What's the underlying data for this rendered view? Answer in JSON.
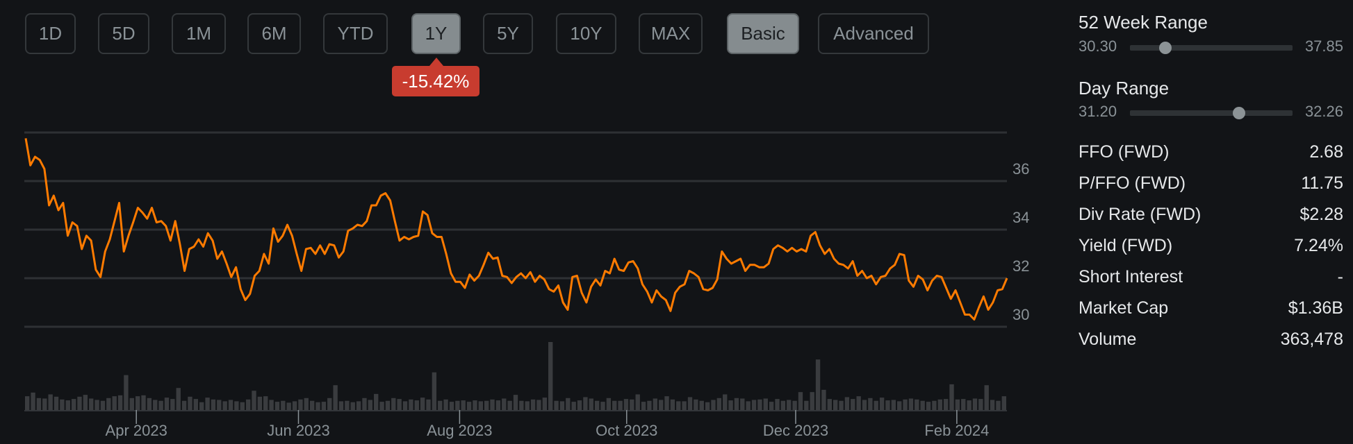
{
  "range_buttons": [
    {
      "label": "1D",
      "active": false
    },
    {
      "label": "5D",
      "active": false
    },
    {
      "label": "1M",
      "active": false
    },
    {
      "label": "6M",
      "active": false
    },
    {
      "label": "YTD",
      "active": false
    },
    {
      "label": "1Y",
      "active": true
    },
    {
      "label": "5Y",
      "active": false
    },
    {
      "label": "10Y",
      "active": false
    },
    {
      "label": "MAX",
      "active": false
    }
  ],
  "mode_buttons": [
    {
      "label": "Basic",
      "active": true
    },
    {
      "label": "Advanced",
      "active": false
    }
  ],
  "change_badge": "-15.42%",
  "colors": {
    "background": "#121417",
    "line": "#ff7b00",
    "badge": "#c83c2f",
    "grid": "#2e3134",
    "volume": "#3a3c3f"
  },
  "stats_panel": {
    "week52": {
      "title": "52 Week Range",
      "low": "30.30",
      "high": "37.85",
      "position": 0.22
    },
    "day": {
      "title": "Day Range",
      "low": "31.20",
      "high": "32.26",
      "position": 0.67
    },
    "rows": [
      {
        "label": "FFO (FWD)",
        "value": "2.68"
      },
      {
        "label": "P/FFO (FWD)",
        "value": "11.75"
      },
      {
        "label": "Div Rate (FWD)",
        "value": "$2.28"
      },
      {
        "label": "Yield (FWD)",
        "value": "7.24%"
      },
      {
        "label": "Short Interest",
        "value": "-"
      },
      {
        "label": "Market Cap",
        "value": "$1.36B"
      },
      {
        "label": "Volume",
        "value": "363,478"
      }
    ]
  },
  "chart_data": {
    "type": "line",
    "title": "",
    "ylim": [
      30,
      38
    ],
    "y_ticks": [
      "30",
      "32",
      "34",
      "36"
    ],
    "y_tick_values": [
      30,
      32,
      34,
      36
    ],
    "grid_values": [
      30,
      32,
      34,
      36,
      38
    ],
    "x_ticks": [
      {
        "label": "Apr 2023",
        "frac": 0.114
      },
      {
        "label": "Jun 2023",
        "frac": 0.279
      },
      {
        "label": "Aug 2023",
        "frac": 0.443
      },
      {
        "label": "Oct 2023",
        "frac": 0.613
      },
      {
        "label": "Dec 2023",
        "frac": 0.785
      },
      {
        "label": "Feb 2024",
        "frac": 0.949
      }
    ],
    "price": [
      37.76,
      36.65,
      37.0,
      36.87,
      36.5,
      35.0,
      35.4,
      34.8,
      35.1,
      33.75,
      34.3,
      34.15,
      33.2,
      33.75,
      33.55,
      32.35,
      32.05,
      33.1,
      33.6,
      34.35,
      35.1,
      33.1,
      33.75,
      34.3,
      34.9,
      34.7,
      34.45,
      34.9,
      34.3,
      34.35,
      34.15,
      33.55,
      34.35,
      33.4,
      32.3,
      33.2,
      33.3,
      33.6,
      33.3,
      33.85,
      33.55,
      32.8,
      33.1,
      32.6,
      32.05,
      32.45,
      31.55,
      31.1,
      31.35,
      32.1,
      32.3,
      33.0,
      32.6,
      34.05,
      33.5,
      33.75,
      34.2,
      33.75,
      33.0,
      32.3,
      33.2,
      33.25,
      33.0,
      33.35,
      33.0,
      33.4,
      33.35,
      32.85,
      33.1,
      33.95,
      34.05,
      34.2,
      34.15,
      34.35,
      35.0,
      35.0,
      35.4,
      35.5,
      35.2,
      34.35,
      33.55,
      33.7,
      33.6,
      33.7,
      33.75,
      34.75,
      34.6,
      33.85,
      33.7,
      33.7,
      33.0,
      32.2,
      31.85,
      31.85,
      31.6,
      32.15,
      31.9,
      32.1,
      32.55,
      33.05,
      32.8,
      32.85,
      32.1,
      32.05,
      31.8,
      32.05,
      32.2,
      32.0,
      32.25,
      31.85,
      32.1,
      31.95,
      31.55,
      31.45,
      31.7,
      31.0,
      30.7,
      32.05,
      32.1,
      31.4,
      31.0,
      31.65,
      31.95,
      31.7,
      32.3,
      32.2,
      32.8,
      32.35,
      32.3,
      32.65,
      32.7,
      32.4,
      31.75,
      31.45,
      31.0,
      31.5,
      31.25,
      31.1,
      30.65,
      31.4,
      31.65,
      31.75,
      32.3,
      32.2,
      32.05,
      31.55,
      31.5,
      31.6,
      31.95,
      33.1,
      32.8,
      32.6,
      32.7,
      32.8,
      32.3,
      32.55,
      32.55,
      32.45,
      32.45,
      32.6,
      33.2,
      33.35,
      33.25,
      33.1,
      33.25,
      33.1,
      33.2,
      33.1,
      33.75,
      33.9,
      33.35,
      33.0,
      33.2,
      32.8,
      32.6,
      32.55,
      32.4,
      32.7,
      32.1,
      32.3,
      32.0,
      32.1,
      31.75,
      32.05,
      32.1,
      32.4,
      32.55,
      33.0,
      32.95,
      31.9,
      31.65,
      32.1,
      31.95,
      31.5,
      31.9,
      32.1,
      32.05,
      31.6,
      31.15,
      31.5,
      31.0,
      30.5,
      30.5,
      30.3,
      30.8,
      31.25,
      30.7,
      31.0,
      31.5,
      31.55,
      32.0
    ],
    "volume": [
      300,
      380,
      260,
      250,
      340,
      290,
      230,
      210,
      240,
      290,
      330,
      250,
      220,
      200,
      260,
      300,
      320,
      760,
      260,
      300,
      320,
      260,
      220,
      200,
      270,
      240,
      480,
      200,
      290,
      240,
      170,
      270,
      230,
      220,
      190,
      220,
      190,
      170,
      230,
      420,
      290,
      300,
      220,
      180,
      200,
      160,
      190,
      230,
      260,
      200,
      170,
      180,
      260,
      540,
      190,
      200,
      170,
      190,
      260,
      220,
      350,
      180,
      200,
      260,
      240,
      190,
      230,
      210,
      270,
      230,
      820,
      200,
      230,
      180,
      200,
      210,
      180,
      210,
      190,
      200,
      230,
      210,
      250,
      200,
      330,
      200,
      190,
      230,
      220,
      270,
      1480,
      200,
      190,
      260,
      180,
      210,
      280,
      250,
      200,
      180,
      260,
      200,
      200,
      240,
      230,
      340,
      180,
      200,
      250,
      220,
      300,
      230,
      190,
      190,
      280,
      230,
      200,
      170,
      220,
      260,
      340,
      210,
      260,
      250,
      190,
      220,
      230,
      250,
      180,
      240,
      200,
      220,
      200,
      390,
      200,
      390,
      1100,
      440,
      240,
      220,
      200,
      280,
      240,
      300,
      220,
      260,
      200,
      270,
      210,
      220,
      190,
      230,
      250,
      230,
      200,
      180,
      200,
      230,
      240,
      560,
      230,
      240,
      210,
      250,
      240,
      540,
      220,
      200,
      300
    ]
  }
}
